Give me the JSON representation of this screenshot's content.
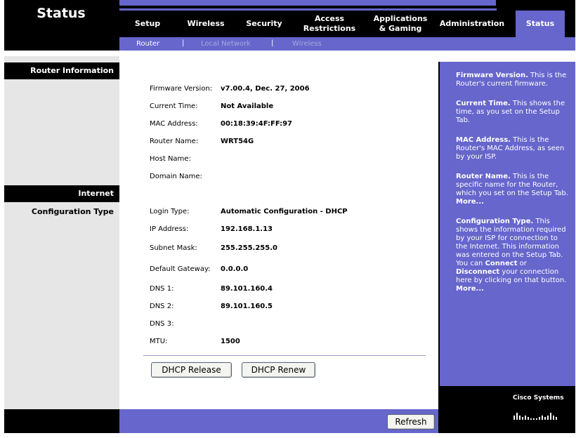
{
  "header": {
    "title": "Status",
    "tabs": [
      {
        "label": "Setup"
      },
      {
        "label": "Wireless"
      },
      {
        "label": "Security"
      },
      {
        "label": "Access Restrictions"
      },
      {
        "label": "Applications & Gaming"
      },
      {
        "label": "Administration"
      },
      {
        "label": "Status"
      }
    ],
    "subtabs": [
      {
        "label": "Router"
      },
      {
        "label": "Local Network"
      },
      {
        "label": "Wireless"
      }
    ],
    "subtab_separator": "|"
  },
  "sections": {
    "router_information": "Router Information",
    "internet": "Internet",
    "configuration_type": "Configuration Type"
  },
  "router": {
    "firmware_label": "Firmware Version:",
    "firmware_value": "v7.00.4, Dec. 27, 2006",
    "time_label": "Current Time:",
    "time_value": "Not Available",
    "mac_label": "MAC Address:",
    "mac_value": "00:18:39:4F:FF:97",
    "name_label": "Router Name:",
    "name_value": "WRT54G",
    "host_label": "Host Name:",
    "domain_label": "Domain Name:"
  },
  "internet": {
    "login_label": "Login Type:",
    "login_value": "Automatic Configuration - DHCP",
    "ip_label": "IP Address:",
    "ip_value": "192.168.1.13",
    "mask_label": "Subnet Mask:",
    "mask_value": "255.255.255.0",
    "gateway_label": "Default Gateway:",
    "gateway_value": "0.0.0.0",
    "dns1_label": "DNS 1:",
    "dns1_value": "89.101.160.4",
    "dns2_label": "DNS 2:",
    "dns2_value": "89.101.160.5",
    "dns3_label": "DNS 3:",
    "mtu_label": "MTU:",
    "mtu_value": "1500"
  },
  "buttons": {
    "dhcp_release": "DHCP Release",
    "dhcp_renew": "DHCP Renew",
    "refresh": "Refresh"
  },
  "help": {
    "firmware_title": "Firmware Version.",
    "firmware_text": " This is the Router's current firmware.",
    "time_title": "Current Time.",
    "time_text": " This shows the time, as you set on the Setup Tab.",
    "mac_title": "MAC Address.",
    "mac_text": " This is the Router's MAC Address, as seen by your ISP.",
    "name_title": "Router Name.",
    "name_text": " This is the specific name for the Router, which you set on the Setup Tab.",
    "more1": "More...",
    "config_title": "Configuration Type.",
    "config_text1": " This shows the information required by your ISP for connection to the Internet. This information was entered on the Setup Tab. You can ",
    "connect": "Connect",
    "config_text2": " or ",
    "disconnect": "Disconnect",
    "config_text3": " your connection here by clicking on that button.",
    "more2": "More..."
  },
  "logo": {
    "text": "Cisco Systems",
    "icon": "cisco-bridge-icon"
  },
  "colors": {
    "accent": "#6666cc",
    "header": "#000000",
    "left_panel": "#e6e6e6"
  }
}
